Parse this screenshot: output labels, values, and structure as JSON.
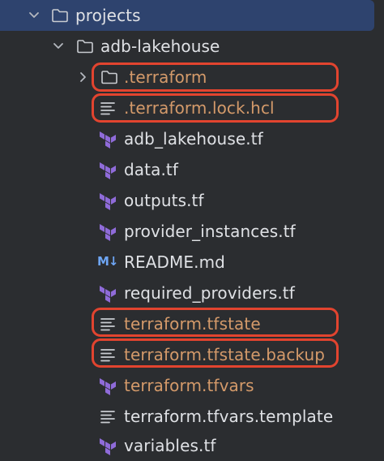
{
  "tree": {
    "root": {
      "label": "projects",
      "expanded": true
    },
    "folder": {
      "label": "adb-lakehouse",
      "expanded": true
    },
    "items": [
      {
        "label": ".terraform",
        "kind": "folder",
        "ignored": true,
        "highlighted": true
      },
      {
        "label": ".terraform.lock.hcl",
        "kind": "text",
        "ignored": true,
        "highlighted": true
      },
      {
        "label": "adb_lakehouse.tf",
        "kind": "terraform",
        "ignored": false,
        "highlighted": false
      },
      {
        "label": "data.tf",
        "kind": "terraform",
        "ignored": false,
        "highlighted": false
      },
      {
        "label": "outputs.tf",
        "kind": "terraform",
        "ignored": false,
        "highlighted": false
      },
      {
        "label": "provider_instances.tf",
        "kind": "terraform",
        "ignored": false,
        "highlighted": false
      },
      {
        "label": "README.md",
        "kind": "markdown",
        "ignored": false,
        "highlighted": false
      },
      {
        "label": "required_providers.tf",
        "kind": "terraform",
        "ignored": false,
        "highlighted": false
      },
      {
        "label": "terraform.tfstate",
        "kind": "text",
        "ignored": true,
        "highlighted": true
      },
      {
        "label": "terraform.tfstate.backup",
        "kind": "text",
        "ignored": true,
        "highlighted": true
      },
      {
        "label": "terraform.tfvars",
        "kind": "terraform",
        "ignored": true,
        "highlighted": false
      },
      {
        "label": "terraform.tfvars.template",
        "kind": "text",
        "ignored": false,
        "highlighted": false
      },
      {
        "label": "variables.tf",
        "kind": "terraform",
        "ignored": false,
        "highlighted": false
      }
    ]
  },
  "markdown_icon_text": "M↓",
  "colors": {
    "background": "#2b2d30",
    "selection": "#2e436e",
    "text": "#dfe1e5",
    "ignored_text": "#d49a6a",
    "highlight_border": "#e2442f",
    "terraform_icon": "#8f6bd9",
    "markdown_icon": "#6ea6f5"
  }
}
